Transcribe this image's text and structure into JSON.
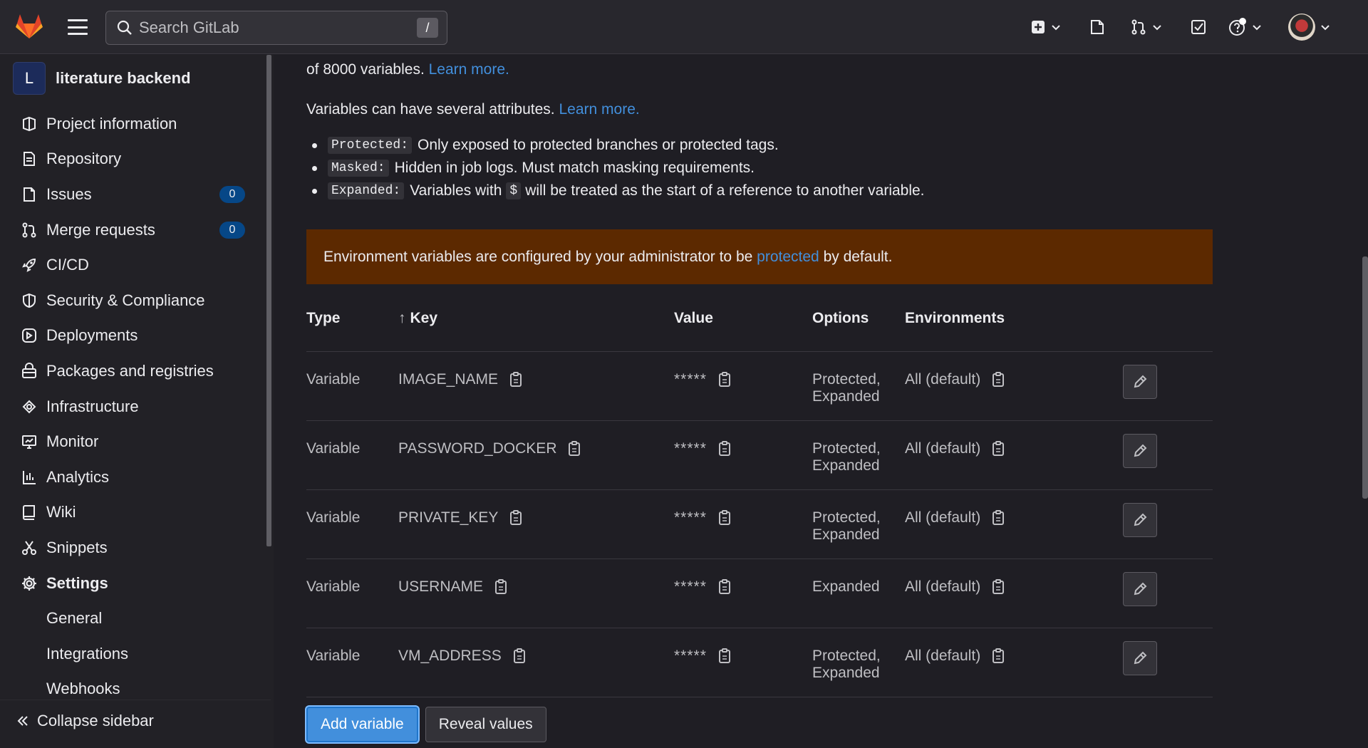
{
  "topbar": {
    "search_placeholder": "Search GitLab",
    "search_shortcut": "/",
    "icons": [
      "gitlab-logo",
      "hamburger-menu-icon",
      "search-icon",
      "plus-square-icon",
      "issues-icon",
      "merge-request-icon",
      "todo-icon",
      "help-icon",
      "user-avatar"
    ]
  },
  "sidebar": {
    "project_initial": "L",
    "project_name": "literature backend",
    "items": [
      {
        "label": "Project information",
        "icon": "project-info-icon"
      },
      {
        "label": "Repository",
        "icon": "document-icon"
      },
      {
        "label": "Issues",
        "icon": "issues-icon",
        "badge": "0"
      },
      {
        "label": "Merge requests",
        "icon": "merge-request-icon",
        "badge": "0"
      },
      {
        "label": "CI/CD",
        "icon": "rocket-icon"
      },
      {
        "label": "Security & Compliance",
        "icon": "shield-icon"
      },
      {
        "label": "Deployments",
        "icon": "deployments-icon"
      },
      {
        "label": "Packages and registries",
        "icon": "package-icon"
      },
      {
        "label": "Infrastructure",
        "icon": "cloud-gear-icon"
      },
      {
        "label": "Monitor",
        "icon": "monitor-icon"
      },
      {
        "label": "Analytics",
        "icon": "analytics-icon"
      },
      {
        "label": "Wiki",
        "icon": "book-icon"
      },
      {
        "label": "Snippets",
        "icon": "scissors-icon"
      },
      {
        "label": "Settings",
        "icon": "gear-icon"
      }
    ],
    "sub_items": [
      "General",
      "Integrations",
      "Webhooks"
    ],
    "collapse_label": "Collapse sidebar"
  },
  "main": {
    "intro_text": "of 8000 variables.",
    "intro_link": "Learn more.",
    "attrs_text": "Variables can have several attributes.",
    "attrs_link": "Learn more.",
    "attributes": [
      {
        "code": "Protected:",
        "text": "Only exposed to protected branches or protected tags."
      },
      {
        "code": "Masked:",
        "text": "Hidden in job logs. Must match masking requirements."
      },
      {
        "code": "Expanded:",
        "text_before": "Variables with",
        "inline_code": "$",
        "text_after": "will be treated as the start of a reference to another variable."
      }
    ],
    "alert": {
      "text_before": "Environment variables are configured by your administrator to be",
      "link": "protected",
      "text_after": "by default."
    },
    "table": {
      "headers": {
        "type": "Type",
        "key_arrow": "↑",
        "key": "Key",
        "value": "Value",
        "options": "Options",
        "environments": "Environments"
      },
      "rows": [
        {
          "type": "Variable",
          "key": "IMAGE_NAME",
          "value": "*****",
          "options_1": "Protected,",
          "options_2": "Expanded",
          "env": "All (default)"
        },
        {
          "type": "Variable",
          "key": "PASSWORD_DOCKER",
          "value": "*****",
          "options_1": "Protected,",
          "options_2": "Expanded",
          "env": "All (default)"
        },
        {
          "type": "Variable",
          "key": "PRIVATE_KEY",
          "value": "*****",
          "options_1": "Protected,",
          "options_2": "Expanded",
          "env": "All (default)"
        },
        {
          "type": "Variable",
          "key": "USERNAME",
          "value": "*****",
          "options_1": "Expanded",
          "options_2": "",
          "env": "All (default)"
        },
        {
          "type": "Variable",
          "key": "VM_ADDRESS",
          "value": "*****",
          "options_1": "Protected,",
          "options_2": "Expanded",
          "env": "All (default)"
        }
      ]
    },
    "buttons": {
      "add": "Add variable",
      "reveal": "Reveal values"
    }
  },
  "colors": {
    "link": "#428fdc",
    "alert_bg": "#5c2900",
    "badge_bg": "#064787",
    "primary": "#428fdc"
  }
}
